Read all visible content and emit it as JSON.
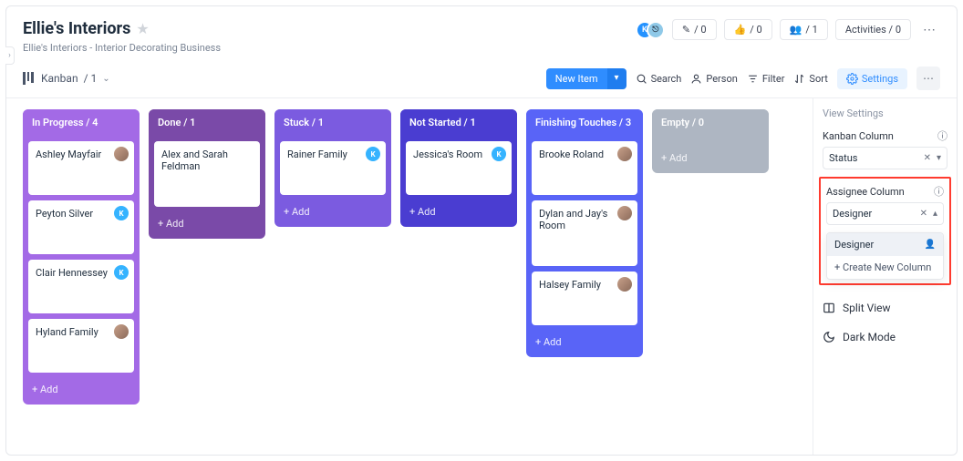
{
  "header": {
    "title": "Ellie's Interiors",
    "subtitle": "Ellie's Interiors - Interior Decorating Business"
  },
  "top_actions": {
    "chat_count": "/ 0",
    "like_count": "/ 0",
    "people_count": "/ 1",
    "activities": "Activities / 0"
  },
  "view_switch": {
    "label": "Kanban",
    "count": "/ 1"
  },
  "toolbar": {
    "new_item": "New Item",
    "search": "Search",
    "person": "Person",
    "filter": "Filter",
    "sort": "Sort",
    "settings": "Settings"
  },
  "columns": [
    {
      "key": "in_progress",
      "title": "In Progress / 4",
      "theme": "c-inprog",
      "cards": [
        {
          "title": "Ashley Mayfair",
          "avatar": "f"
        },
        {
          "title": "Peyton Silver",
          "avatar": "k"
        },
        {
          "title": "Clair Hennessey",
          "avatar": "k"
        },
        {
          "title": "Hyland Family",
          "avatar": "f"
        }
      ],
      "add": "+ Add"
    },
    {
      "key": "done",
      "title": "Done / 1",
      "theme": "c-done",
      "cards": [
        {
          "title": "Alex and Sarah Feldman",
          "avatar": ""
        }
      ],
      "add": "+ Add"
    },
    {
      "key": "stuck",
      "title": "Stuck / 1",
      "theme": "c-stuck",
      "cards": [
        {
          "title": "Rainer Family",
          "avatar": "k"
        }
      ],
      "add": "+ Add"
    },
    {
      "key": "not_started",
      "title": "Not Started / 1",
      "theme": "c-nstart",
      "cards": [
        {
          "title": "Jessica's Room",
          "avatar": "k"
        }
      ],
      "add": "+ Add"
    },
    {
      "key": "finishing",
      "title": "Finishing Touches / 3",
      "theme": "c-finish",
      "cards": [
        {
          "title": "Brooke Roland",
          "avatar": "f"
        },
        {
          "title": "Dylan and Jay's Room",
          "avatar": "f"
        },
        {
          "title": "Halsey Family",
          "avatar": "f"
        }
      ],
      "add": "+ Add"
    },
    {
      "key": "empty",
      "title": "Empty / 0",
      "theme": "c-empty",
      "cards": [],
      "add": "+ Add"
    }
  ],
  "view_settings": {
    "heading": "View Settings",
    "kanban_label": "Kanban Column",
    "kanban_value": "Status",
    "assignee_label": "Assignee Column",
    "assignee_value": "Designer",
    "dropdown": {
      "selected": "Designer",
      "create": "+ Create New Column"
    },
    "split_view": "Split View",
    "dark_mode": "Dark Mode"
  }
}
